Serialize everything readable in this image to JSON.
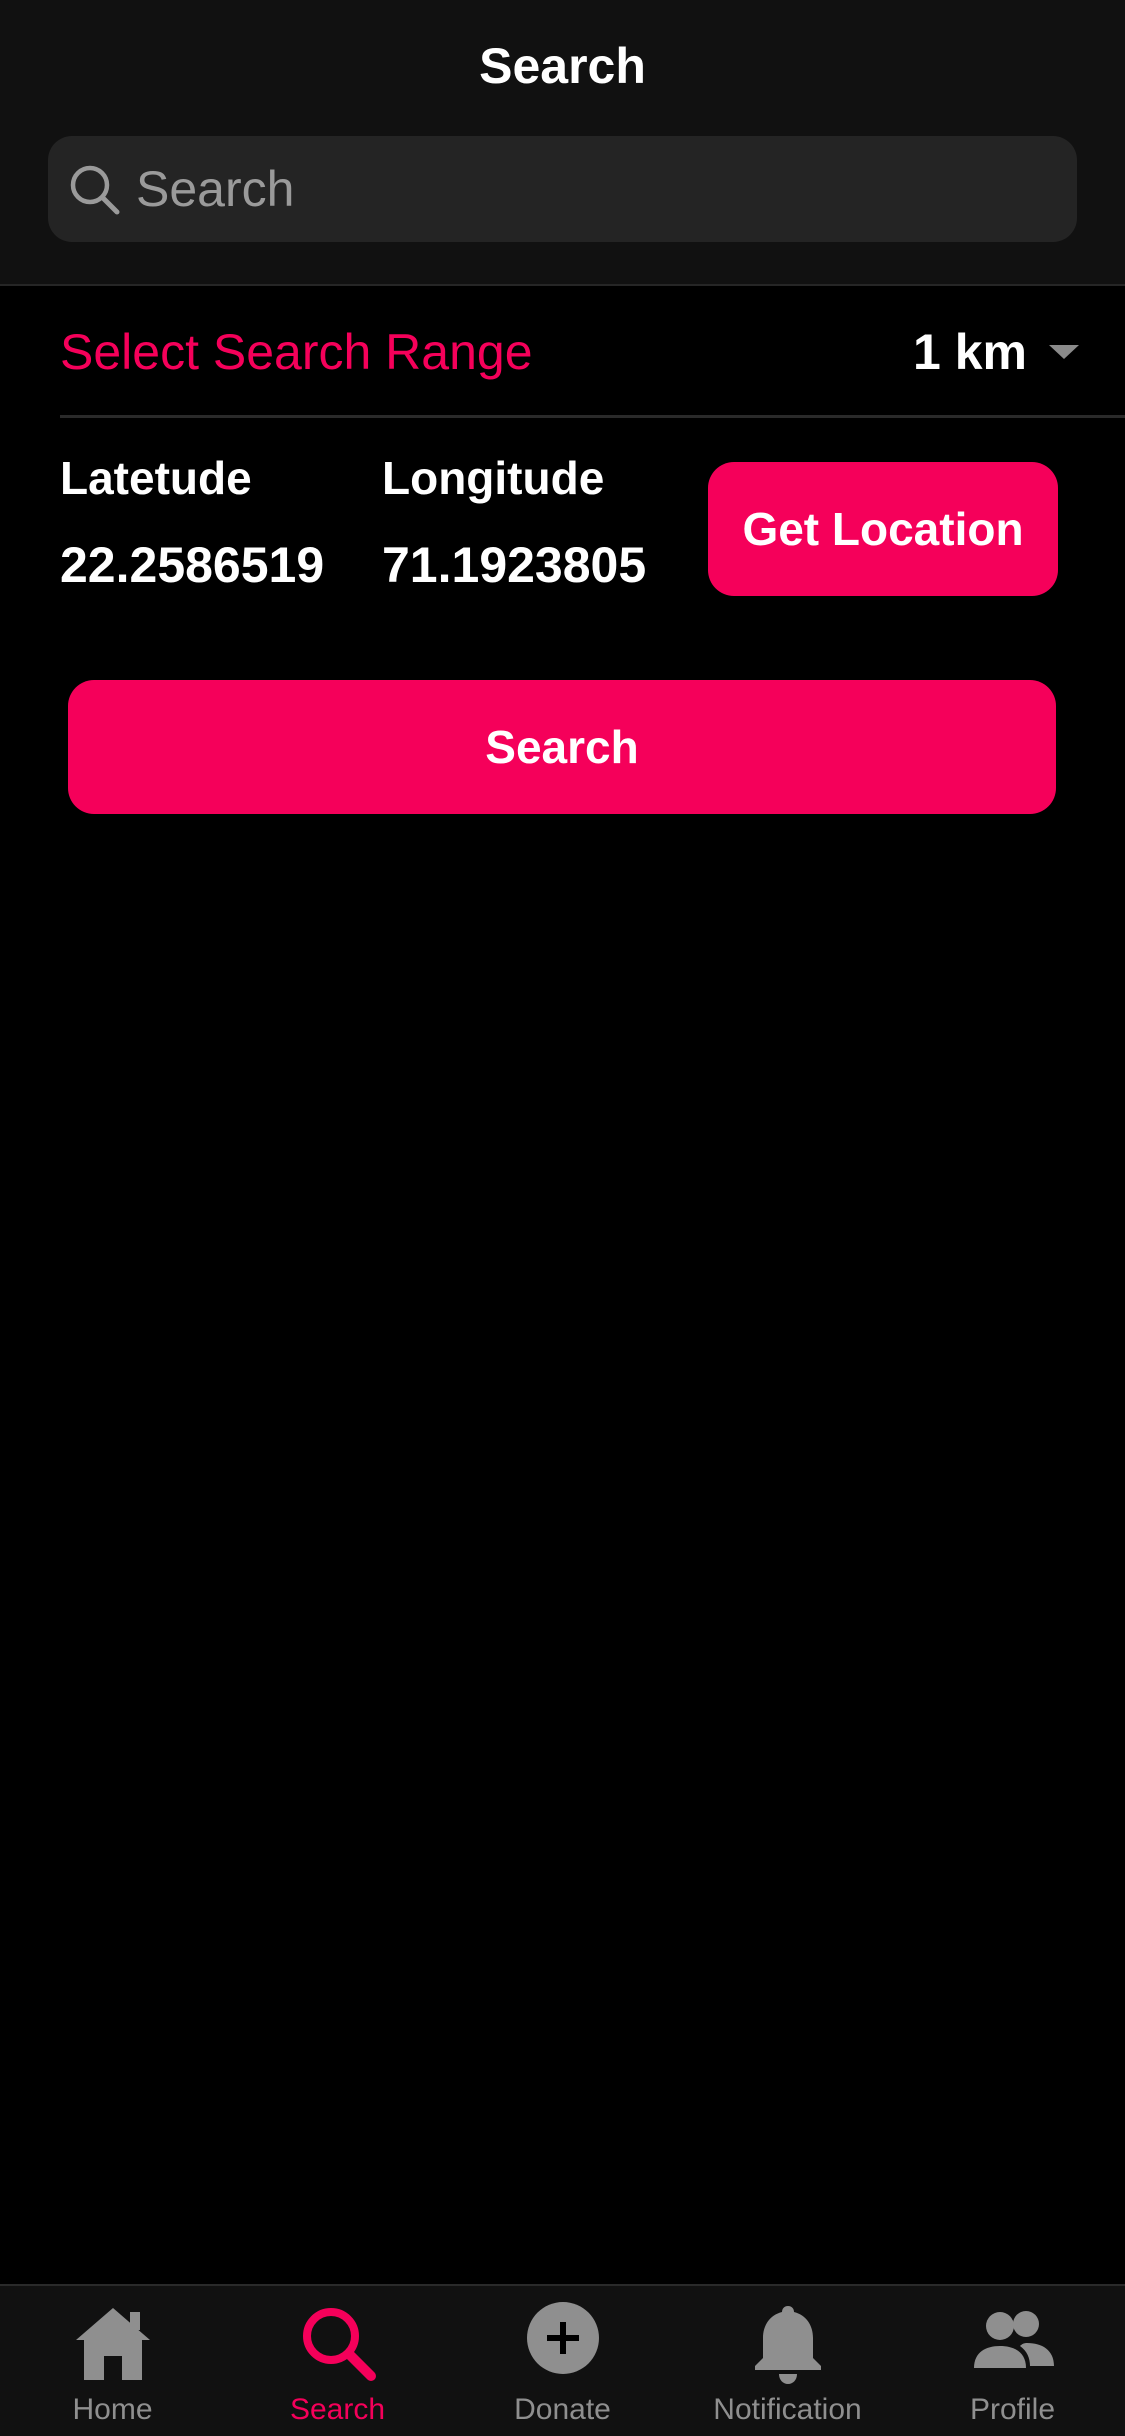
{
  "header": {
    "title": "Search",
    "search": {
      "placeholder": "Search",
      "value": ""
    }
  },
  "range": {
    "label": "Select Search Range",
    "value": "1 km"
  },
  "location": {
    "latitude_label": "Latetude",
    "latitude_value": "22.2586519",
    "longitude_label": "Longitude",
    "longitude_value": "71.1923805",
    "get_location_label": "Get Location"
  },
  "actions": {
    "search_label": "Search"
  },
  "tabs": [
    {
      "label": "Home",
      "icon": "home-icon",
      "active": false
    },
    {
      "label": "Search",
      "icon": "search-icon",
      "active": true
    },
    {
      "label": "Donate",
      "icon": "add-circle-icon",
      "active": false
    },
    {
      "label": "Notification",
      "icon": "bell-icon",
      "active": false
    },
    {
      "label": "Profile",
      "icon": "people-icon",
      "active": false
    }
  ],
  "colors": {
    "accent": "#f5005a",
    "background": "#000000",
    "header_background": "#111111",
    "inactive": "#8f8f8f"
  }
}
